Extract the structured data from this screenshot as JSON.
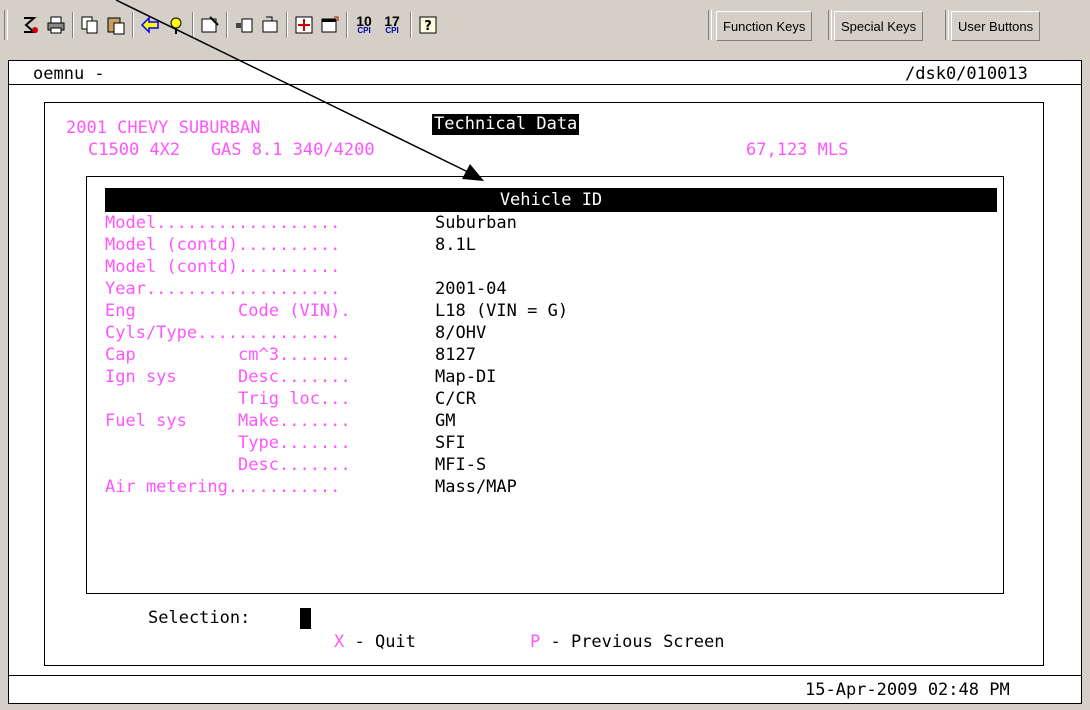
{
  "toolbar": {
    "icons": [
      "settings-icon",
      "print-icon",
      "copy-icon",
      "paste-icon",
      "back-arrow-icon",
      "pointer-icon",
      "properties-icon",
      "edit-icon",
      "open-folder-icon",
      "expand-icon",
      "window-icon",
      "cpi-10-icon",
      "cpi-17-icon",
      "help-icon"
    ],
    "cpi10_num": "10",
    "cpi17_num": "17",
    "cpi_unit": "CPI",
    "function_keys": "Function Keys",
    "special_keys": "Special Keys",
    "user_buttons": "User Buttons"
  },
  "terminal": {
    "program": "oemnu -",
    "path": "/dsk0/010013",
    "vehicle_line1": "2001 CHEVY SUBURBAN",
    "vehicle_line2": "C1500 4X2   GAS 8.1 340/4200",
    "mileage": "67,123 MLS",
    "title": "Technical Data",
    "section_header": "Vehicle ID",
    "rows": [
      {
        "label": "Model..................",
        "value": "Suburban"
      },
      {
        "label": "Model (contd)..........",
        "value": "8.1L"
      },
      {
        "label": "Model (contd)..........",
        "value": ""
      },
      {
        "label": "Year...................",
        "value": "2001-04"
      },
      {
        "label": "Eng          Code (VIN).",
        "value": "L18 (VIN = G)"
      },
      {
        "label": "Cyls/Type..............",
        "value": "8/OHV"
      },
      {
        "label": "Cap          cm^3.......",
        "value": "8127"
      },
      {
        "label": "Ign sys      Desc.......",
        "value": "Map-DI"
      },
      {
        "label": "             Trig loc...",
        "value": "C/CR"
      },
      {
        "label": "Fuel sys     Make.......",
        "value": "GM"
      },
      {
        "label": "             Type.......",
        "value": "SFI"
      },
      {
        "label": "             Desc.......",
        "value": "MFI-S"
      },
      {
        "label": "Air metering...........",
        "value": "Mass/MAP"
      }
    ],
    "selection_label": "Selection:",
    "quit_key": "X",
    "quit_label": " - Quit",
    "prev_key": "P",
    "prev_label": " - Previous Screen",
    "datetime": "15-Apr-2009 02:48 PM"
  }
}
